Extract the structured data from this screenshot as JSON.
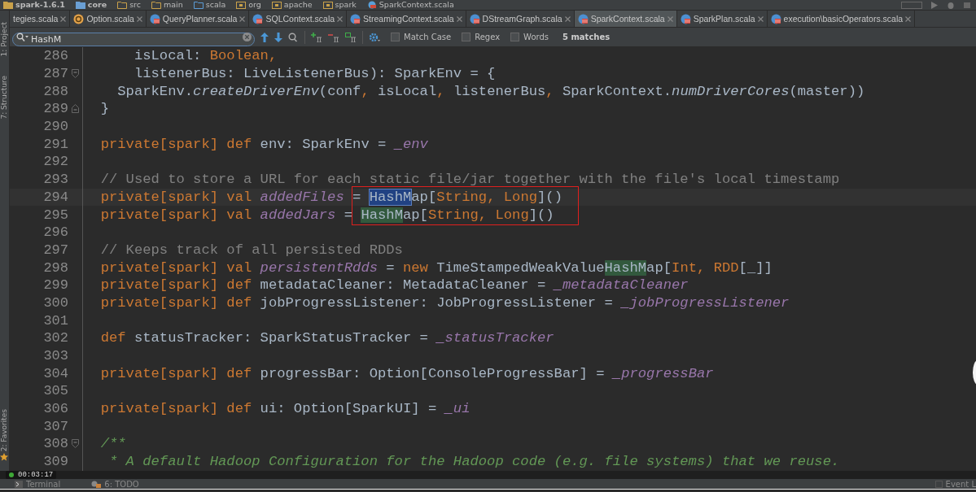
{
  "breadcrumbs": [
    {
      "label": "spark-1.6.1",
      "kind": "project"
    },
    {
      "label": "core",
      "kind": "module"
    },
    {
      "label": "src",
      "kind": "folder"
    },
    {
      "label": "main",
      "kind": "folder"
    },
    {
      "label": "scala",
      "kind": "source"
    },
    {
      "label": "org",
      "kind": "package"
    },
    {
      "label": "apache",
      "kind": "package"
    },
    {
      "label": "spark",
      "kind": "package"
    },
    {
      "label": "SparkContext.scala",
      "kind": "file"
    }
  ],
  "side_tools": [
    {
      "label": "1: Project",
      "kind": "project"
    },
    {
      "label": "7: Structure",
      "kind": "structure"
    },
    {
      "label": "2: Favorites",
      "kind": "favorites"
    }
  ],
  "tabs": [
    {
      "label": "tegies.scala",
      "kind": "plain",
      "selected": false
    },
    {
      "label": "Option.scala",
      "kind": "object",
      "selected": false
    },
    {
      "label": "QueryPlanner.scala",
      "kind": "class",
      "selected": false
    },
    {
      "label": "SQLContext.scala",
      "kind": "class",
      "selected": false
    },
    {
      "label": "StreamingContext.scala",
      "kind": "class",
      "selected": false
    },
    {
      "label": "DStreamGraph.scala",
      "kind": "class",
      "selected": false
    },
    {
      "label": "SparkContext.scala",
      "kind": "class",
      "selected": true
    },
    {
      "label": "SparkPlan.scala",
      "kind": "class",
      "selected": false
    },
    {
      "label": "execution\\basicOperators.scala",
      "kind": "class",
      "selected": false
    }
  ],
  "find_bar": {
    "query": "HashM",
    "options": [
      {
        "label": "Match Case",
        "checked": false
      },
      {
        "label": "Regex",
        "checked": false
      },
      {
        "label": "Words",
        "checked": false
      }
    ],
    "result": "5 matches"
  },
  "editor": {
    "lines": [
      {
        "number": "286",
        "current": false,
        "boxed": false,
        "kind": "plain",
        "tokens": [
          {
            "text": "      isLocal: ",
            "kind": "plain"
          },
          {
            "text": "Boolean",
            "kind": "type"
          },
          {
            "text": ",",
            "kind": "keyword"
          }
        ]
      },
      {
        "number": "287",
        "current": false,
        "boxed": false,
        "kind": "fold-start",
        "tokens": [
          {
            "text": "      listenerBus: LiveListenerBus): SparkEnv = {",
            "kind": "plain"
          }
        ]
      },
      {
        "number": "288",
        "current": false,
        "boxed": false,
        "kind": "plain",
        "tokens": [
          {
            "text": "    SparkEnv.",
            "kind": "plain"
          },
          {
            "text": "createDriverEnv",
            "kind": "method"
          },
          {
            "text": "(conf",
            "kind": "plain"
          },
          {
            "text": ", ",
            "kind": "keyword"
          },
          {
            "text": "isLocal",
            "kind": "plain"
          },
          {
            "text": ", ",
            "kind": "keyword"
          },
          {
            "text": "listenerBus",
            "kind": "plain"
          },
          {
            "text": ", ",
            "kind": "keyword"
          },
          {
            "text": "SparkContext.",
            "kind": "plain"
          },
          {
            "text": "numDriverCores",
            "kind": "method"
          },
          {
            "text": "(master))",
            "kind": "plain"
          }
        ]
      },
      {
        "number": "289",
        "current": false,
        "boxed": false,
        "kind": "fold-end",
        "tokens": [
          {
            "text": "  }",
            "kind": "plain"
          }
        ]
      },
      {
        "number": "290",
        "current": false,
        "boxed": false,
        "kind": "plain"
      },
      {
        "number": "291",
        "current": false,
        "boxed": false,
        "kind": "plain",
        "tokens": [
          {
            "text": "  private[spark] def",
            "kind": "keyword"
          },
          {
            "text": " env: SparkEnv = ",
            "kind": "plain"
          },
          {
            "text": "_env",
            "kind": "field"
          }
        ]
      },
      {
        "number": "292",
        "current": false,
        "boxed": false,
        "kind": "plain"
      },
      {
        "number": "293",
        "current": false,
        "boxed": false,
        "kind": "plain",
        "tokens": [
          {
            "text": "  // Used to store a URL for each static file/jar together with the file's local timestamp",
            "kind": "comment"
          }
        ]
      },
      {
        "number": "294",
        "current": true,
        "boxed": true,
        "kind": "plain",
        "tokens": [
          {
            "text": "  private[spark] val ",
            "kind": "keyword"
          },
          {
            "text": "addedFiles",
            "kind": "field"
          },
          {
            "text": " = ",
            "kind": "plain"
          },
          {
            "text": "HashM",
            "kind": "match-current"
          },
          {
            "text": "ap[",
            "kind": "plain"
          },
          {
            "text": "String",
            "kind": "type"
          },
          {
            "text": ", ",
            "kind": "keyword"
          },
          {
            "text": "Long",
            "kind": "type"
          },
          {
            "text": "]()",
            "kind": "plain"
          }
        ]
      },
      {
        "number": "295",
        "current": false,
        "boxed": true,
        "kind": "plain",
        "tokens": [
          {
            "text": "  private[spark] val ",
            "kind": "keyword"
          },
          {
            "text": "addedJars",
            "kind": "field"
          },
          {
            "text": " = ",
            "kind": "plain"
          },
          {
            "text": "HashM",
            "kind": "match"
          },
          {
            "text": "ap[",
            "kind": "plain"
          },
          {
            "text": "String",
            "kind": "type"
          },
          {
            "text": ", ",
            "kind": "keyword"
          },
          {
            "text": "Long",
            "kind": "type"
          },
          {
            "text": "]()",
            "kind": "plain"
          }
        ]
      },
      {
        "number": "296",
        "current": false,
        "boxed": false,
        "kind": "plain"
      },
      {
        "number": "297",
        "current": false,
        "boxed": false,
        "kind": "plain",
        "tokens": [
          {
            "text": "  // Keeps track of all persisted RDDs",
            "kind": "comment"
          }
        ]
      },
      {
        "number": "298",
        "current": false,
        "boxed": false,
        "kind": "plain",
        "tokens": [
          {
            "text": "  private[spark] val ",
            "kind": "keyword"
          },
          {
            "text": "persistentRdds",
            "kind": "field"
          },
          {
            "text": " = ",
            "kind": "plain"
          },
          {
            "text": "new",
            "kind": "keyword"
          },
          {
            "text": " TimeStampedWeakValue",
            "kind": "plain"
          },
          {
            "text": "HashM",
            "kind": "match"
          },
          {
            "text": "ap[",
            "kind": "plain"
          },
          {
            "text": "Int",
            "kind": "type"
          },
          {
            "text": ", ",
            "kind": "keyword"
          },
          {
            "text": "RDD",
            "kind": "type"
          },
          {
            "text": "[_]]",
            "kind": "plain"
          }
        ]
      },
      {
        "number": "299",
        "current": false,
        "boxed": false,
        "kind": "plain",
        "tokens": [
          {
            "text": "  private[spark] def",
            "kind": "keyword"
          },
          {
            "text": " metadataCleaner: MetadataCleaner = ",
            "kind": "plain"
          },
          {
            "text": "_metadataCleaner",
            "kind": "field"
          }
        ]
      },
      {
        "number": "300",
        "current": false,
        "boxed": false,
        "kind": "plain",
        "tokens": [
          {
            "text": "  private[spark] def",
            "kind": "keyword"
          },
          {
            "text": " jobProgressListener: JobProgressListener = ",
            "kind": "plain"
          },
          {
            "text": "_jobProgressListener",
            "kind": "field"
          }
        ]
      },
      {
        "number": "301",
        "current": false,
        "boxed": false,
        "kind": "plain"
      },
      {
        "number": "302",
        "current": false,
        "boxed": false,
        "kind": "plain",
        "tokens": [
          {
            "text": "  def",
            "kind": "keyword"
          },
          {
            "text": " statusTracker: SparkStatusTracker = ",
            "kind": "plain"
          },
          {
            "text": "_statusTracker",
            "kind": "field"
          }
        ]
      },
      {
        "number": "303",
        "current": false,
        "boxed": false,
        "kind": "plain"
      },
      {
        "number": "304",
        "current": false,
        "boxed": false,
        "kind": "plain",
        "tokens": [
          {
            "text": "  private[spark] def",
            "kind": "keyword"
          },
          {
            "text": " progressBar: Option[ConsoleProgressBar] = ",
            "kind": "plain"
          },
          {
            "text": "_progressBar",
            "kind": "field"
          }
        ]
      },
      {
        "number": "305",
        "current": false,
        "boxed": false,
        "kind": "plain"
      },
      {
        "number": "306",
        "current": false,
        "boxed": false,
        "kind": "plain",
        "tokens": [
          {
            "text": "  private[spark] def",
            "kind": "keyword"
          },
          {
            "text": " ui: Option[SparkUI] = ",
            "kind": "plain"
          },
          {
            "text": "_ui",
            "kind": "field"
          }
        ]
      },
      {
        "number": "307",
        "current": false,
        "boxed": false,
        "kind": "plain"
      },
      {
        "number": "308",
        "current": false,
        "boxed": false,
        "kind": "fold-start",
        "tokens": [
          {
            "text": "  /**",
            "kind": "doc"
          }
        ]
      },
      {
        "number": "309",
        "current": false,
        "boxed": false,
        "kind": "plain",
        "tokens": [
          {
            "text": "   * A default Hadoop Configuration for the Hadoop code (e.g. file systems) that we reuse.",
            "kind": "doc"
          }
        ]
      }
    ]
  },
  "timer": "00:03:17",
  "status_bar": {
    "left": [
      {
        "label": "Terminal",
        "kind": "terminal"
      },
      {
        "label": "6: TODO",
        "kind": "todo"
      }
    ],
    "right": [
      {
        "label": "Event L",
        "kind": "event"
      }
    ]
  }
}
